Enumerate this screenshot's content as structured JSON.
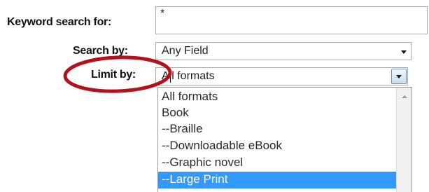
{
  "form": {
    "keyword_label": "Keyword search for:",
    "keyword_value": "*",
    "search_by_label": "Search by:",
    "search_by_value": "Any Field",
    "limit_by_label": "Limit by:",
    "limit_by_value": "All formats"
  },
  "dropdown": {
    "options": [
      {
        "label": "All formats",
        "selected": false
      },
      {
        "label": "Book",
        "selected": false
      },
      {
        "label": "--Braille",
        "selected": false
      },
      {
        "label": "--Downloadable eBook",
        "selected": false
      },
      {
        "label": "--Graphic novel",
        "selected": false
      },
      {
        "label": "--Large Print",
        "selected": true
      }
    ]
  },
  "colors": {
    "highlight": "#3399ff",
    "annotation_circle": "#b3111d"
  },
  "icons": {
    "search_by_arrow": "chevron-down-icon",
    "limit_by_arrow": "chevron-down-icon",
    "scroll_up": "chevron-up-icon"
  }
}
